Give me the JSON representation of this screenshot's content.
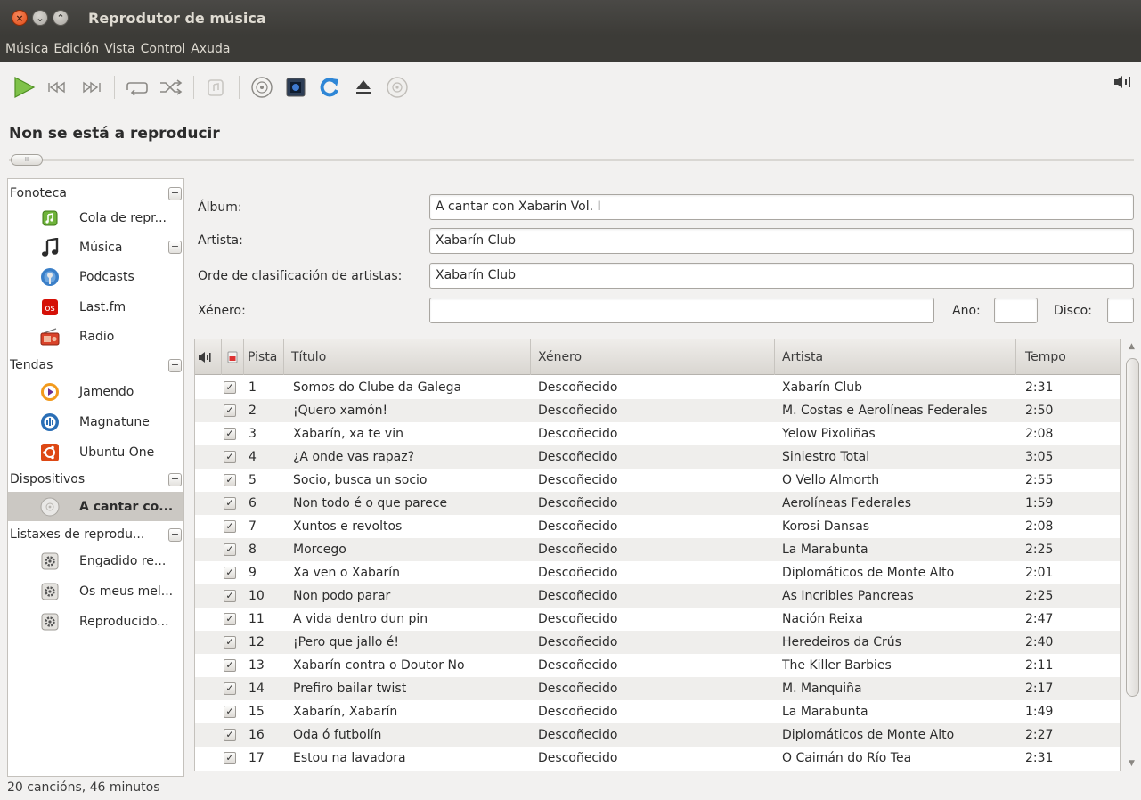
{
  "window": {
    "title": "Reprodutor de música",
    "close_glyph": "×",
    "min_glyph": "⌄",
    "max_glyph": "⌃"
  },
  "menu": [
    "Música",
    "Edición",
    "Vista",
    "Control",
    "Axuda"
  ],
  "toolbar": {
    "icons": [
      "play-icon",
      "previous-icon",
      "next-icon",
      "repeat-icon",
      "shuffle-icon",
      "queue-icon",
      "disc-icon",
      "visualization-icon",
      "refresh-icon",
      "eject-icon",
      "burn-icon",
      "volume-icon"
    ]
  },
  "now_playing": "Non se está a reproducir",
  "seek": {
    "knob_label": "II",
    "progress": 0
  },
  "sidebar": {
    "categories": [
      {
        "label": "Fonoteca",
        "toggle": "−"
      },
      {
        "label": "Tendas",
        "toggle": "−"
      },
      {
        "label": "Dispositivos",
        "toggle": "−"
      },
      {
        "label": "Listaxes de reprodu...",
        "toggle": "−"
      }
    ],
    "sources": [
      {
        "label": "Cola de repr...",
        "icon": "play-queue-icon"
      },
      {
        "label": "Música",
        "icon": "music-note-icon",
        "expand": "+"
      },
      {
        "label": "Podcasts",
        "icon": "podcast-icon"
      },
      {
        "label": "Last.fm",
        "icon": "lastfm-icon"
      },
      {
        "label": "Radio",
        "icon": "radio-icon"
      },
      {
        "label": "Jamendo",
        "icon": "jamendo-icon"
      },
      {
        "label": "Magnatune",
        "icon": "magnatune-icon"
      },
      {
        "label": "Ubuntu One",
        "icon": "ubuntu-one-icon"
      },
      {
        "label": "A cantar co...",
        "icon": "cd-icon"
      },
      {
        "label": "Engadido re...",
        "icon": "smart-playlist-icon"
      },
      {
        "label": "Os meus mel...",
        "icon": "smart-playlist-icon"
      },
      {
        "label": "Reproducido...",
        "icon": "smart-playlist-icon"
      }
    ]
  },
  "form": {
    "album_label": "Álbum:",
    "album_value": "A cantar con Xabarín Vol. I",
    "artist_label": "Artista:",
    "artist_value": "Xabarín Club",
    "sort_label": "Orde de clasificación de artistas:",
    "sort_value": "Xabarín Club",
    "genre_label": "Xénero:",
    "genre_value": "",
    "year_label": "Ano:",
    "year_value": "",
    "disc_label": "Disco:",
    "disc_value": ""
  },
  "table": {
    "headers": {
      "track": "Pista",
      "title": "Título",
      "genre": "Xénero",
      "artist": "Artista",
      "time": "Tempo"
    },
    "check_glyph": "✓",
    "rows": [
      {
        "track": "1",
        "title": "Somos do Clube da Galega",
        "genre": "Descoñecido",
        "artist": "Xabarín Club",
        "time": "2:31"
      },
      {
        "track": "2",
        "title": "¡Quero xamón!",
        "genre": "Descoñecido",
        "artist": "M. Costas e Aerolíneas Federales",
        "time": "2:50"
      },
      {
        "track": "3",
        "title": "Xabarín, xa te vin",
        "genre": "Descoñecido",
        "artist": "Yelow Pixoliñas",
        "time": "2:08"
      },
      {
        "track": "4",
        "title": "¿A onde vas rapaz?",
        "genre": "Descoñecido",
        "artist": "Siniestro Total",
        "time": "3:05"
      },
      {
        "track": "5",
        "title": "Socio, busca un socio",
        "genre": "Descoñecido",
        "artist": "O Vello Almorth",
        "time": "2:55"
      },
      {
        "track": "6",
        "title": "Non todo é o que parece",
        "genre": "Descoñecido",
        "artist": "Aerolíneas Federales",
        "time": "1:59"
      },
      {
        "track": "7",
        "title": "Xuntos e revoltos",
        "genre": "Descoñecido",
        "artist": "Korosi Dansas",
        "time": "2:08"
      },
      {
        "track": "8",
        "title": "Morcego",
        "genre": "Descoñecido",
        "artist": "La Marabunta",
        "time": "2:25"
      },
      {
        "track": "9",
        "title": "Xa ven o Xabarín",
        "genre": "Descoñecido",
        "artist": "Diplomáticos de Monte Alto",
        "time": "2:01"
      },
      {
        "track": "10",
        "title": "Non podo parar",
        "genre": "Descoñecido",
        "artist": "As Incribles Pancreas",
        "time": "2:25"
      },
      {
        "track": "11",
        "title": "A vida dentro dun pin",
        "genre": "Descoñecido",
        "artist": "Nación Reixa",
        "time": "2:47"
      },
      {
        "track": "12",
        "title": "¡Pero que jallo é!",
        "genre": "Descoñecido",
        "artist": "Heredeiros da Crús",
        "time": "2:40"
      },
      {
        "track": "13",
        "title": "Xabarín contra o Doutor No",
        "genre": "Descoñecido",
        "artist": "The Killer Barbies",
        "time": "2:11"
      },
      {
        "track": "14",
        "title": "Prefiro bailar twist",
        "genre": "Descoñecido",
        "artist": "M. Manquiña",
        "time": "2:17"
      },
      {
        "track": "15",
        "title": "Xabarín, Xabarín",
        "genre": "Descoñecido",
        "artist": "La Marabunta",
        "time": "1:49"
      },
      {
        "track": "16",
        "title": "Oda ó futbolín",
        "genre": "Descoñecido",
        "artist": "Diplomáticos de Monte Alto",
        "time": "2:27"
      },
      {
        "track": "17",
        "title": "Estou na lavadora",
        "genre": "Descoñecido",
        "artist": "O Caimán do Río Tea",
        "time": "2:31"
      }
    ]
  },
  "scrollbar": {
    "up_glyph": "▲",
    "down_glyph": "▼"
  },
  "status": "20 cancións, 46 minutos"
}
